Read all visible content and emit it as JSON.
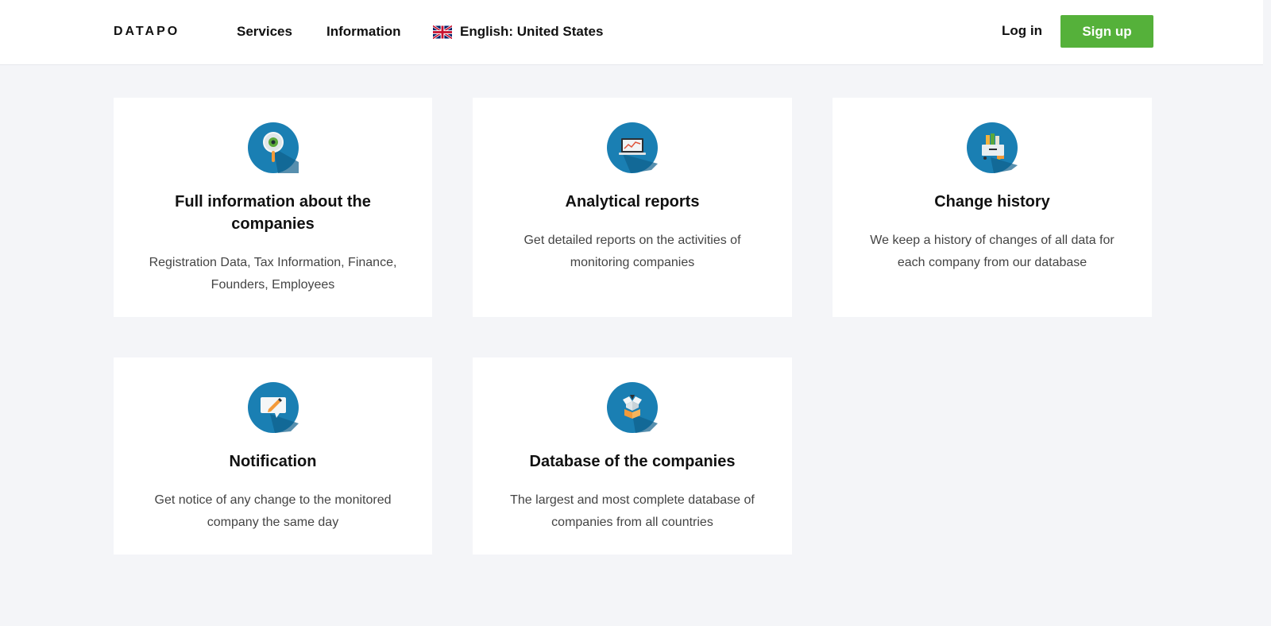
{
  "header": {
    "logo": "DATAPO",
    "nav": {
      "services": "Services",
      "information": "Information"
    },
    "language": {
      "flag_icon": "uk-flag-icon",
      "label": "English: United States"
    },
    "login_label": "Log in",
    "signup_label": "Sign up"
  },
  "colors": {
    "accent_green": "#55b13a",
    "icon_blue": "#1a7fb3",
    "background": "#f4f5f8"
  },
  "features": [
    {
      "icon": "magnifier-icon",
      "title": "Full information about the companies",
      "description": "Registration Data, Tax Information, Finance, Founders, Employees"
    },
    {
      "icon": "analytics-laptop-icon",
      "title": "Analytical reports",
      "description": "Get detailed reports on the activities of monitoring companies"
    },
    {
      "icon": "archive-folders-icon",
      "title": "Change history",
      "description": "We keep a history of changes of all data for each company from our database"
    },
    {
      "icon": "notification-message-icon",
      "title": "Notification",
      "description": "Get notice of any change to the monitored company the same day"
    },
    {
      "icon": "database-box-icon",
      "title": "Database of the companies",
      "description": "The largest and most complete database of companies from all countries"
    }
  ]
}
